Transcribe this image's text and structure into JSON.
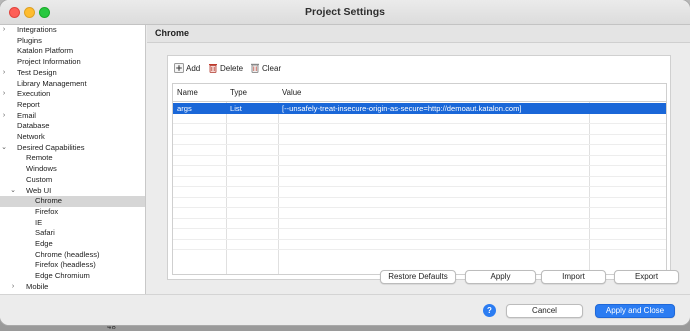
{
  "window": {
    "title": "Project Settings"
  },
  "background": {
    "glyph_left": "P",
    "glyph_bottom": "48"
  },
  "tree": {
    "items": [
      {
        "label": "Integrations",
        "level": 0,
        "twisty": "›"
      },
      {
        "label": "Plugins",
        "level": 0,
        "twisty": ""
      },
      {
        "label": "Katalon Platform",
        "level": 0,
        "twisty": ""
      },
      {
        "label": "Project Information",
        "level": 0,
        "twisty": ""
      },
      {
        "label": "Test Design",
        "level": 0,
        "twisty": "›"
      },
      {
        "label": "Library Management",
        "level": 0,
        "twisty": ""
      },
      {
        "label": "Execution",
        "level": 0,
        "twisty": "›"
      },
      {
        "label": "Report",
        "level": 0,
        "twisty": ""
      },
      {
        "label": "Email",
        "level": 0,
        "twisty": "›"
      },
      {
        "label": "Database",
        "level": 0,
        "twisty": ""
      },
      {
        "label": "Network",
        "level": 0,
        "twisty": ""
      },
      {
        "label": "Desired Capabilities",
        "level": 0,
        "twisty": "⌄"
      },
      {
        "label": "Remote",
        "level": 1,
        "twisty": ""
      },
      {
        "label": "Windows",
        "level": 1,
        "twisty": ""
      },
      {
        "label": "Custom",
        "level": 1,
        "twisty": ""
      },
      {
        "label": "Web UI",
        "level": 1,
        "twisty": "⌄"
      },
      {
        "label": "Chrome",
        "level": 2,
        "twisty": "",
        "selected": true
      },
      {
        "label": "Firefox",
        "level": 2,
        "twisty": ""
      },
      {
        "label": "IE",
        "level": 2,
        "twisty": ""
      },
      {
        "label": "Safari",
        "level": 2,
        "twisty": ""
      },
      {
        "label": "Edge",
        "level": 2,
        "twisty": ""
      },
      {
        "label": "Chrome (headless)",
        "level": 2,
        "twisty": ""
      },
      {
        "label": "Firefox (headless)",
        "level": 2,
        "twisty": ""
      },
      {
        "label": "Edge Chromium",
        "level": 2,
        "twisty": ""
      },
      {
        "label": "Mobile",
        "level": 1,
        "twisty": "›"
      }
    ]
  },
  "content": {
    "title": "Chrome"
  },
  "toolbar": {
    "add_label": "Add",
    "delete_label": "Delete",
    "clear_label": "Clear"
  },
  "table": {
    "headers": {
      "name": "Name",
      "type": "Type",
      "value": "Value"
    },
    "rows": [
      {
        "name": "args",
        "type": "List",
        "value": "[--unsafely-treat-insecure-origin-as-secure=http://demoaut.katalon.com]",
        "selected": true
      }
    ],
    "empty_row_count": 13
  },
  "buttons": {
    "restore_defaults": "Restore Defaults",
    "apply": "Apply",
    "import": "Import",
    "export": "Export"
  },
  "footer": {
    "help_label": "?",
    "cancel": "Cancel",
    "apply_and_close": "Apply and Close"
  },
  "colors": {
    "selection": "#1a67d8",
    "primary_button": "#2b7cf2"
  }
}
